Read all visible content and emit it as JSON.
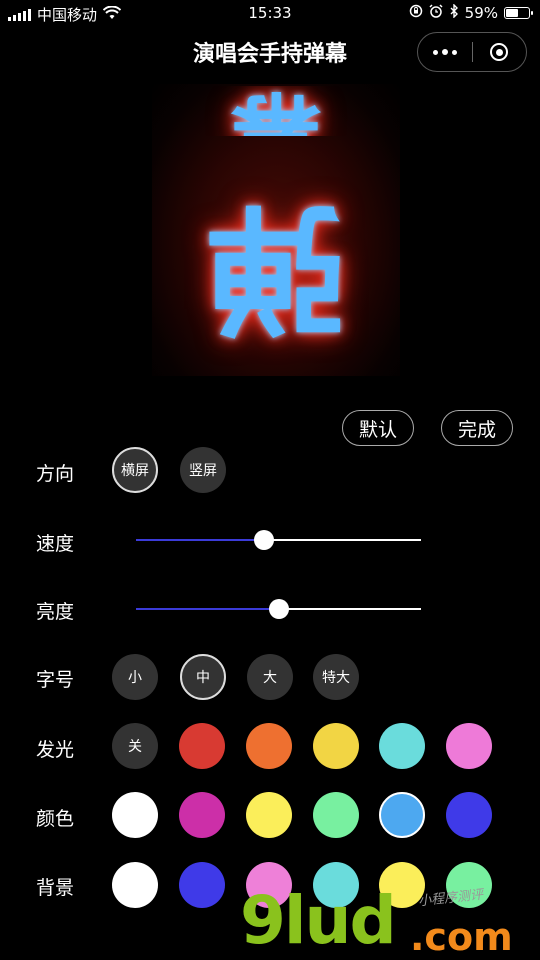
{
  "status": {
    "carrier": "中国移动",
    "time": "15:33",
    "battery": "59%",
    "battery_level": 0.59
  },
  "nav": {
    "title": "演唱会手持弹幕"
  },
  "preview": {
    "text_top": "幕",
    "text_main": "弹"
  },
  "actions": {
    "default_label": "默认",
    "done_label": "完成"
  },
  "direction": {
    "label": "方向",
    "options": [
      "横屏",
      "竖屏"
    ],
    "selected": "横屏"
  },
  "speed": {
    "label": "速度",
    "value": 0.45
  },
  "brightness": {
    "label": "亮度",
    "value": 0.5
  },
  "font_size": {
    "label": "字号",
    "options": [
      "小",
      "中",
      "大",
      "特大"
    ],
    "selected": "中"
  },
  "glow": {
    "label": "发光",
    "off_label": "关",
    "colors": [
      "#d83a32",
      "#ee7030",
      "#f2d544",
      "#6adcdc",
      "#ee7ad8"
    ],
    "selected_index": 0
  },
  "color": {
    "label": "颜色",
    "colors": [
      "#ffffff",
      "#cc2fa8",
      "#fbee5a",
      "#78f0a0",
      "#4da8f0",
      "#3f3ae8"
    ],
    "selected_index": 4
  },
  "background": {
    "label": "背景",
    "colors": [
      "#ffffff",
      "#3f3ae8",
      "#ee80d8",
      "#6adcdc",
      "#fbee5a",
      "#78f0a0"
    ]
  },
  "watermark": {
    "brand": "9lud",
    "domain": ".com",
    "note": "小程序测评"
  }
}
